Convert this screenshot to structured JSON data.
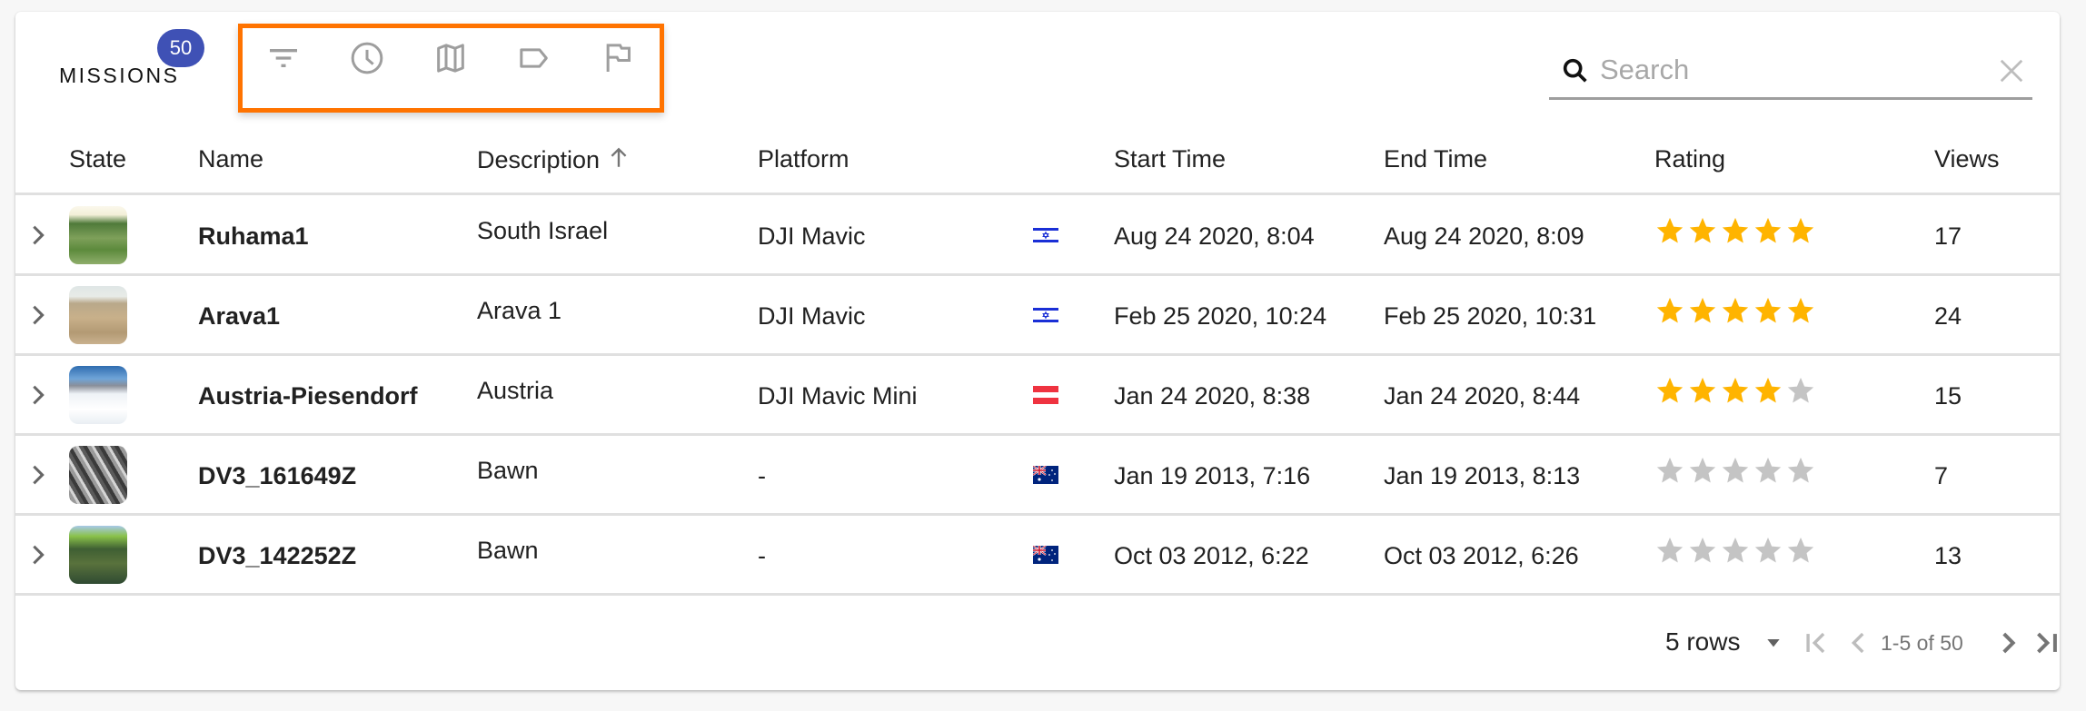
{
  "header": {
    "title": "MISSIONS",
    "badge_count": "50",
    "toolbar_icons": [
      "filter-icon",
      "clock-icon",
      "map-icon",
      "label-icon",
      "flag-icon"
    ],
    "toolbar_highlight_color": "#ff7300",
    "badge_color": "#3f51b5"
  },
  "search": {
    "placeholder": "Search",
    "value": ""
  },
  "table": {
    "columns": [
      "State",
      "Name",
      "Description",
      "Platform",
      "",
      "Start Time",
      "End Time",
      "Rating",
      "Views"
    ],
    "sorted_column": "Description",
    "sort_direction": "ascending",
    "rows": [
      {
        "name": "Ruhama1",
        "description": "South Israel",
        "platform": "DJI Mavic",
        "country": "Israel",
        "start": "Aug 24 2020, 8:04",
        "end": "Aug 24 2020, 8:09",
        "rating": 5,
        "views": "17"
      },
      {
        "name": "Arava1",
        "description": "Arava 1",
        "platform": "DJI Mavic",
        "country": "Israel",
        "start": "Feb 25 2020, 10:24",
        "end": "Feb 25 2020, 10:31",
        "rating": 5,
        "views": "24"
      },
      {
        "name": "Austria-Piesendorf",
        "description": "Austria",
        "platform": "DJI Mavic Mini",
        "country": "Austria",
        "start": "Jan 24 2020, 8:38",
        "end": "Jan 24 2020, 8:44",
        "rating": 4,
        "views": "15"
      },
      {
        "name": "DV3_161649Z",
        "description": "Bawn",
        "platform": "-",
        "country": "Australia",
        "start": "Jan 19 2013, 7:16",
        "end": "Jan 19 2013, 8:13",
        "rating": 0,
        "views": "7"
      },
      {
        "name": "DV3_142252Z",
        "description": "Bawn",
        "platform": "-",
        "country": "Australia",
        "start": "Oct 03 2012, 6:22",
        "end": "Oct 03 2012, 6:26",
        "rating": 0,
        "views": "13"
      }
    ],
    "rating_max": 5,
    "star_color_on": "#ffb400",
    "star_color_off": "#c4c4c4"
  },
  "pagination": {
    "rows_per_page": "5 rows",
    "range": "1-5 of 50"
  }
}
